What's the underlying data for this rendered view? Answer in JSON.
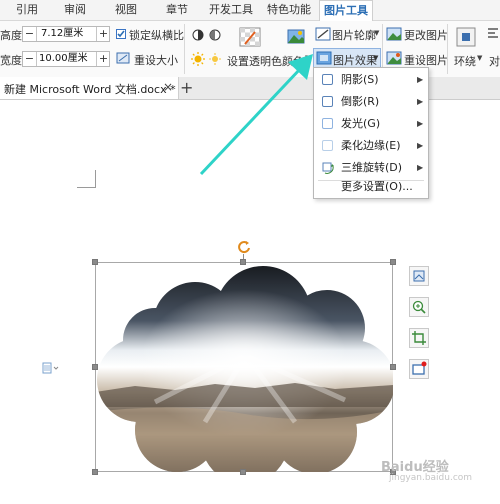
{
  "menu": {
    "tabs": [
      "引用",
      "审阅",
      "视图",
      "章节",
      "开发工具",
      "特色功能",
      "图片工具"
    ],
    "active": "图片工具"
  },
  "ribbon": {
    "height_label": "高度:",
    "height_value": "7.12厘米",
    "width_label": "宽度:",
    "width_value": "10.00厘米",
    "lock_ratio": "锁定纵横比",
    "reset_size": "重设大小",
    "set_transparent": "设置透明色",
    "color": "颜色",
    "picture_outline": "图片轮廓",
    "picture_effect": "图片效果",
    "change_picture": "更改图片",
    "reset_picture": "重设图片",
    "wrap": "环绕",
    "align": "对"
  },
  "tabbar": {
    "doc_title": "新建 Microsoft Word 文档.docx *",
    "close": "×",
    "add": "+"
  },
  "effect_menu": {
    "items": [
      {
        "label": "阴影(S)",
        "icon": "shadow-icon"
      },
      {
        "label": "倒影(R)",
        "icon": "reflection-icon"
      },
      {
        "label": "发光(G)",
        "icon": "glow-icon"
      },
      {
        "label": "柔化边缘(E)",
        "icon": "soft-edge-icon"
      },
      {
        "label": "三维旋转(D)",
        "icon": "3d-rotation-icon"
      }
    ],
    "more": "更多设置(O)..."
  },
  "watermark": {
    "site": "Baidu经验",
    "url": "jingyan.baidu.com"
  },
  "colors": {
    "accent": "#2d6fb5",
    "arrow": "#2ed3c8"
  }
}
